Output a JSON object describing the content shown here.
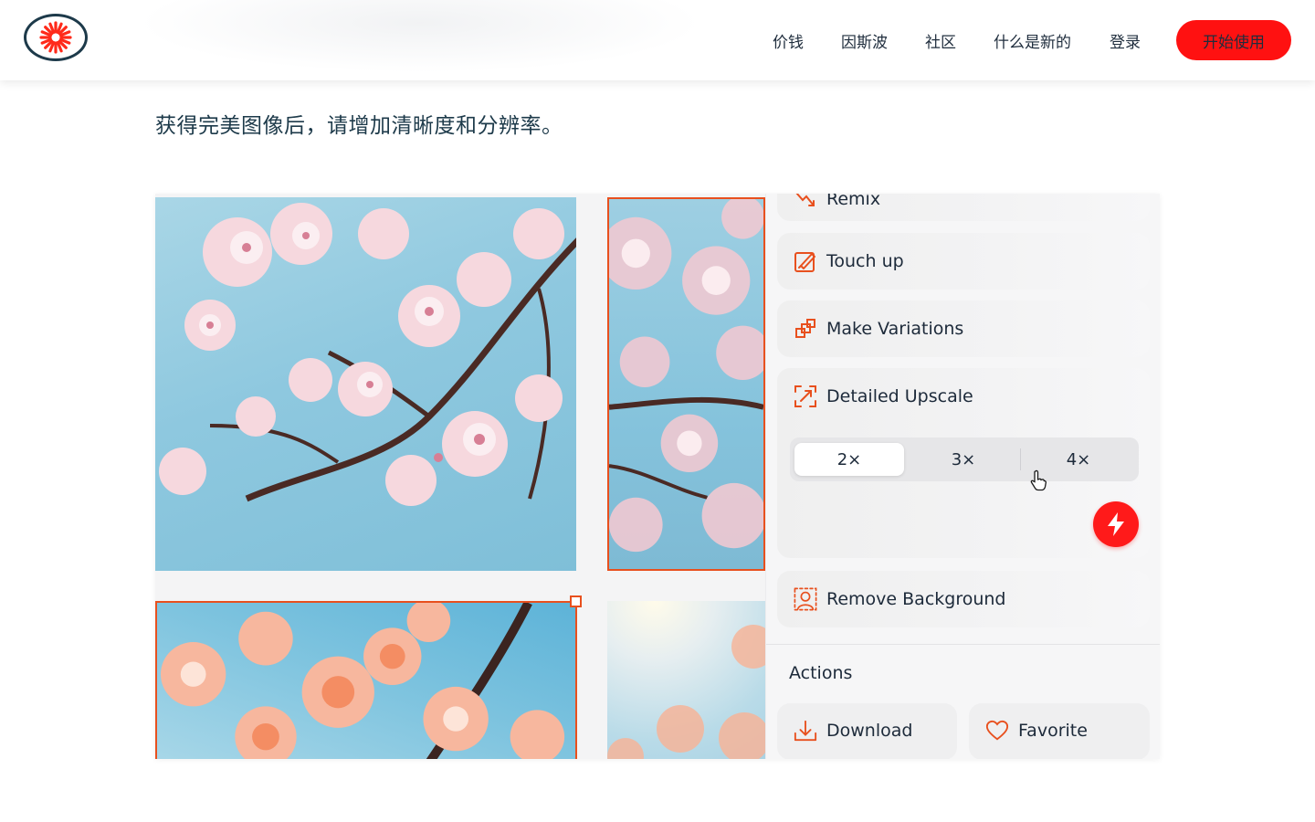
{
  "header": {
    "logo_icon": "starburst-logo-icon",
    "nav": [
      "价钱",
      "因斯波",
      "社区",
      "什么是新的",
      "登录"
    ],
    "cta_label": "开始使用"
  },
  "tagline": "获得完美图像后，请增加清晰度和分辨率。",
  "panel": {
    "remix_label": "Remix",
    "touch_up_label": "Touch up",
    "variations_label": "Make Variations",
    "upscale_label": "Detailed Upscale",
    "upscale_options": [
      "2×",
      "3×",
      "4×"
    ],
    "upscale_selected": "2×",
    "remove_bg_label": "Remove Background",
    "actions_title": "Actions",
    "download_label": "Download",
    "favorite_label": "Favorite"
  },
  "colors": {
    "accent": "#ff1111",
    "selection": "#e8501e",
    "text": "#1d3a4a"
  }
}
